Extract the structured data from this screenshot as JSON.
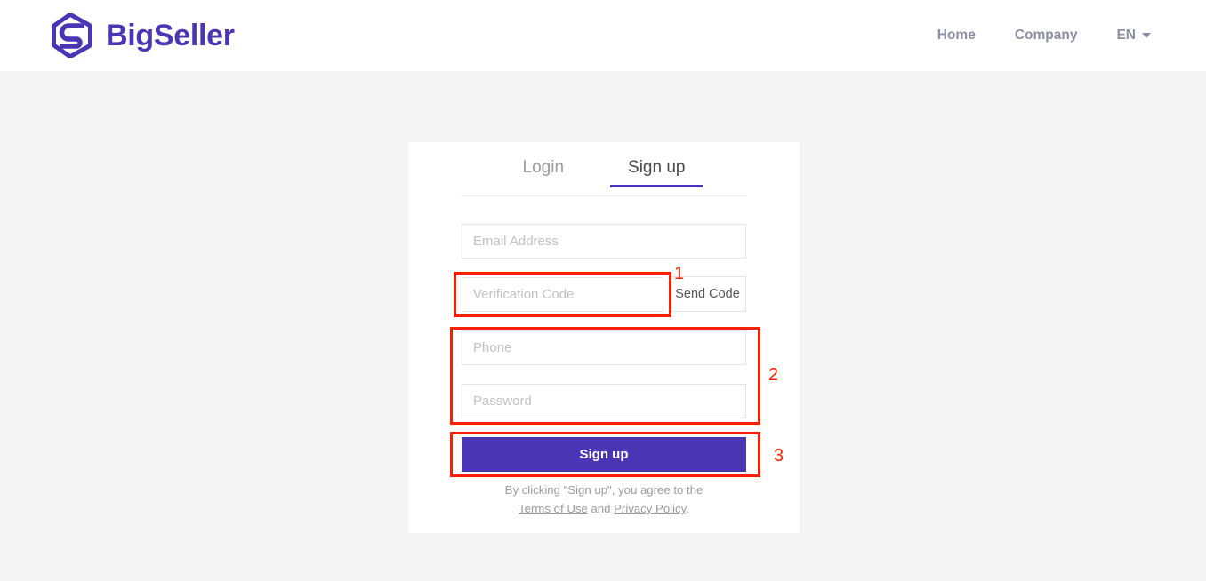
{
  "brand": {
    "name": "BigSeller",
    "logo_icon": "bigseller-hexagon-s-logo",
    "color": "#4a35b5"
  },
  "header": {
    "nav": [
      {
        "label": "Home",
        "name": "home"
      },
      {
        "label": "Company",
        "name": "company"
      }
    ],
    "language": {
      "label": "EN",
      "caret_icon": "chevron-down-icon"
    }
  },
  "card": {
    "tabs": [
      {
        "label": "Login",
        "active": false
      },
      {
        "label": "Sign up",
        "active": true
      }
    ],
    "fields": {
      "email": {
        "value": "",
        "placeholder": "Email Address"
      },
      "verification_code": {
        "value": "",
        "placeholder": "Verification Code"
      },
      "phone": {
        "value": "",
        "placeholder": "Phone"
      },
      "password": {
        "value": "",
        "placeholder": "Password"
      }
    },
    "send_code_label": "Send Code",
    "submit_label": "Sign up",
    "legal": {
      "line1": "By clicking \"Sign up\", you agree to the",
      "terms_link": "Terms of Use",
      "conjunction": " and ",
      "privacy_link": "Privacy Policy",
      "period": "."
    }
  },
  "annotations": {
    "color": "#f92000",
    "markers": [
      {
        "number": "1",
        "target": "verification-code-field"
      },
      {
        "number": "2",
        "target": "phone-and-password-fields"
      },
      {
        "number": "3",
        "target": "sign-up-button"
      }
    ]
  },
  "colors": {
    "accent": "#4a35b5",
    "page_background": "#f4f4f4",
    "card_background": "#ffffff",
    "annotation_red": "#f92000"
  }
}
